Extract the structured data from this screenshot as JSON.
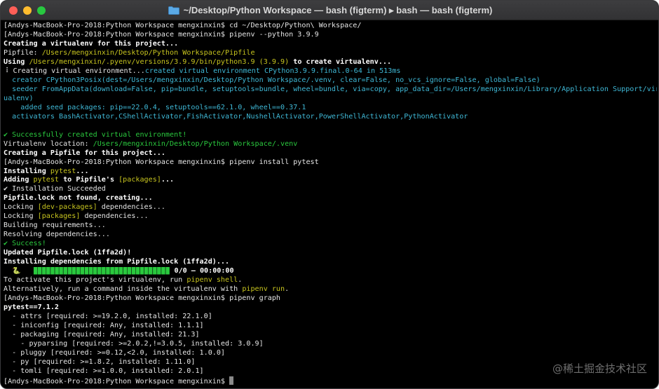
{
  "window": {
    "title": "~/Desktop/Python Workspace — bash (figterm) ▸ bash — bash (figterm)"
  },
  "watermark": "@稀土掘金技术社区",
  "terminal": {
    "lines": [
      [
        {
          "t": "[Andys-MacBook-Pro-2018:Python Workspace mengxinxin$ cd ~/Desktop/Python\\ Workspace/"
        }
      ],
      [
        {
          "t": "[Andys-MacBook-Pro-2018:Python Workspace mengxinxin$ pipenv --python 3.9.9"
        }
      ],
      [
        {
          "t": "Creating a virtualenv for this project...",
          "s": "b"
        }
      ],
      [
        {
          "t": "Pipfile: "
        },
        {
          "t": "/Users/mengxinxin/Desktop/Python Workspace/Pipfile",
          "s": "y"
        }
      ],
      [
        {
          "t": "Using ",
          "s": "b"
        },
        {
          "t": "/Users/mengxinxin/.pyenv/versions/3.9.9/bin/python3.9",
          "s": "y"
        },
        {
          "t": " (3.9.9)",
          "s": "y"
        },
        {
          "t": " to create virtualenv...",
          "s": "b"
        }
      ],
      [
        {
          "t": "⠸ Creating virtual environment..."
        },
        {
          "t": "created virtual environment CPython3.9.9.final.0-64 in 513ms",
          "s": "c"
        }
      ],
      [
        {
          "t": "  creator CPython3Posix(dest=/Users/mengxinxin/Desktop/Python Workspace/.venv, clear=False, no_vcs_ignore=False, global=False)",
          "s": "c"
        }
      ],
      [
        {
          "t": "  seeder FromAppData(download=False, pip=bundle, setuptools=bundle, wheel=bundle, via=copy, app_data_dir=/Users/mengxinxin/Library/Application Support/virt",
          "s": "c"
        }
      ],
      [
        {
          "t": "ualenv)",
          "s": "c"
        }
      ],
      [
        {
          "t": "    added seed packages: pip==22.0.4, setuptools==62.1.0, wheel==0.37.1",
          "s": "c"
        }
      ],
      [
        {
          "t": "  activators BashActivator,CShellActivator,FishActivator,NushellActivator,PowerShellActivator,PythonActivator",
          "s": "c"
        }
      ],
      [
        {
          "t": ""
        }
      ],
      [
        {
          "t": "✔ Successfully created virtual environment!",
          "s": "g"
        }
      ],
      [
        {
          "t": "Virtualenv location: "
        },
        {
          "t": "/Users/mengxinxin/Desktop/Python Workspace/.venv",
          "s": "g"
        }
      ],
      [
        {
          "t": "Creating a Pipfile for this project...",
          "s": "b"
        }
      ],
      [
        {
          "t": "[Andys-MacBook-Pro-2018:Python Workspace mengxinxin$ pipenv install pytest"
        }
      ],
      [
        {
          "t": "Installing ",
          "s": "b"
        },
        {
          "t": "pytest",
          "s": "y"
        },
        {
          "t": "...",
          "s": "b"
        }
      ],
      [
        {
          "t": "Adding ",
          "s": "b"
        },
        {
          "t": "pytest",
          "s": "y"
        },
        {
          "t": " to Pipfile's ",
          "s": "b"
        },
        {
          "t": "[packages]",
          "s": "y"
        },
        {
          "t": "...",
          "s": "b"
        }
      ],
      [
        {
          "t": "✔ Installation Succeeded"
        }
      ],
      [
        {
          "t": "Pipfile.lock not found, creating...",
          "s": "b"
        }
      ],
      [
        {
          "t": "Locking "
        },
        {
          "t": "[dev-packages]",
          "s": "y"
        },
        {
          "t": " dependencies..."
        }
      ],
      [
        {
          "t": "Locking "
        },
        {
          "t": "[packages]",
          "s": "y"
        },
        {
          "t": " dependencies..."
        }
      ],
      [
        {
          "t": "Building requirements..."
        }
      ],
      [
        {
          "t": "Resolving dependencies..."
        }
      ],
      [
        {
          "t": "✔ Success!",
          "s": "g"
        }
      ],
      [
        {
          "t": "Updated Pipfile.lock (1ffa2d)!",
          "s": "b"
        }
      ],
      [
        {
          "t": "Installing dependencies from Pipfile.lock (1ffa2d)...",
          "s": "b"
        }
      ],
      [
        {
          "t": "  🐍   "
        },
        {
          "t": "▉▉▉▉▉▉▉▉▉▉▉▉▉▉▉▉▉▉▉▉▉▉▉▉▉▉▉▉▉▉▉▉",
          "s": "bar"
        },
        {
          "t": " 0/0 — ",
          "s": "b"
        },
        {
          "t": "00:00:00",
          "s": "b"
        }
      ],
      [
        {
          "t": "To activate this project's virtualenv, run "
        },
        {
          "t": "pipenv shell",
          "s": "y"
        },
        {
          "t": "."
        }
      ],
      [
        {
          "t": "Alternatively, run a command inside the virtualenv with "
        },
        {
          "t": "pipenv run",
          "s": "y"
        },
        {
          "t": "."
        }
      ],
      [
        {
          "t": "[Andys-MacBook-Pro-2018:Python Workspace mengxinxin$ pipenv graph"
        }
      ],
      [
        {
          "t": "pytest==7.1.2",
          "s": "b"
        }
      ],
      [
        {
          "t": "  - attrs [required: >=19.2.0, installed: 22.1.0]"
        }
      ],
      [
        {
          "t": "  - iniconfig [required: Any, installed: 1.1.1]"
        }
      ],
      [
        {
          "t": "  - packaging [required: Any, installed: 21.3]"
        }
      ],
      [
        {
          "t": "    - pyparsing [required: >=2.0.2,!=3.0.5, installed: 3.0.9]"
        }
      ],
      [
        {
          "t": "  - pluggy [required: >=0.12,<2.0, installed: 1.0.0]"
        }
      ],
      [
        {
          "t": "  - py [required: >=1.8.2, installed: 1.11.0]"
        }
      ],
      [
        {
          "t": "  - tomli [required: >=1.0.0, installed: 2.0.1]"
        }
      ],
      [
        {
          "t": "[Andys-MacBook-Pro-2018:Python Workspace mengxinxin$ "
        }
      ]
    ]
  },
  "colors": {
    "background": "#000000",
    "bold_white": "#ffffff",
    "yellow": "#c7c41f",
    "cyan": "#3fb8d6",
    "green": "#2ac93e"
  }
}
